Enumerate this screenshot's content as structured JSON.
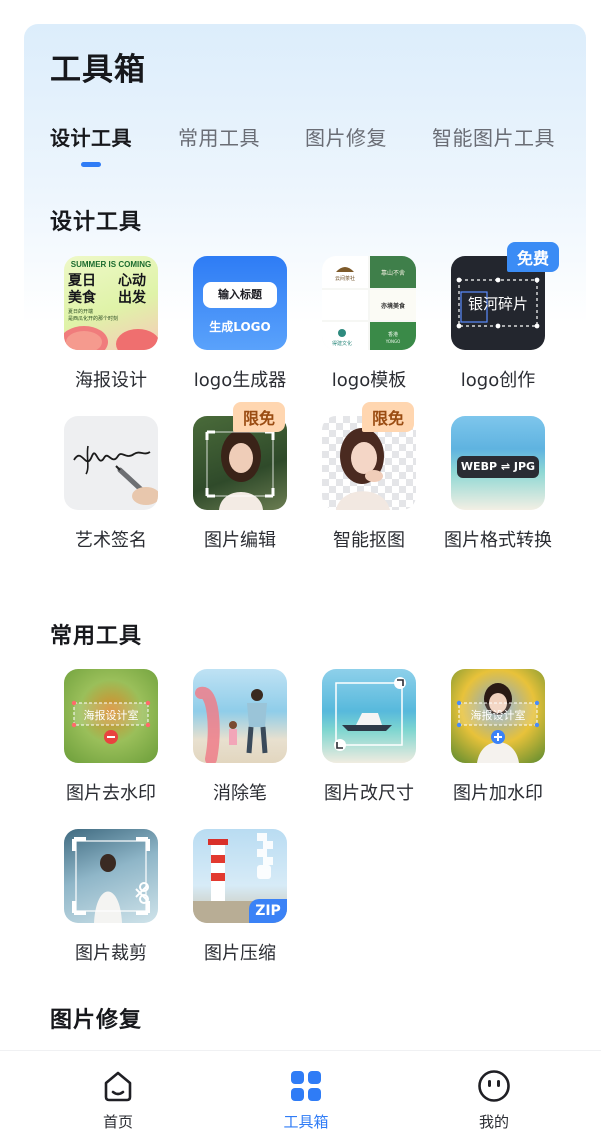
{
  "header": {
    "title": "工具箱"
  },
  "tabs": [
    {
      "label": "设计工具",
      "active": true
    },
    {
      "label": "常用工具",
      "active": false
    },
    {
      "label": "图片修复",
      "active": false
    },
    {
      "label": "智能图片工具",
      "active": false
    }
  ],
  "sections": {
    "design": {
      "title": "设计工具",
      "tools": [
        {
          "label": "海报设计",
          "thumb_text": [
            "SUMMER IS COMING",
            "夏日",
            "心动",
            "美食",
            "出发",
            "夏日的开端",
            "是西瓜化开的那个时刻"
          ]
        },
        {
          "label": "logo生成器",
          "thumb_text": [
            "输入标题",
            "生成LOGO"
          ]
        },
        {
          "label": "logo模板",
          "thumb_text": [
            "云间茶社",
            "靠山不舍",
            "亦境美食",
            "得建文化",
            "香港",
            "YONGO"
          ]
        },
        {
          "label": "logo创作",
          "badge": "免费",
          "thumb_text": [
            "银河碎片"
          ]
        },
        {
          "label": "艺术签名"
        },
        {
          "label": "图片编辑",
          "badge": "限免"
        },
        {
          "label": "智能抠图",
          "badge": "限免"
        },
        {
          "label": "图片格式转换",
          "thumb_text": [
            "WEBP ⇌ JPG"
          ]
        }
      ]
    },
    "common": {
      "title": "常用工具",
      "tools": [
        {
          "label": "图片去水印",
          "thumb_text": [
            "海报设计室"
          ]
        },
        {
          "label": "消除笔"
        },
        {
          "label": "图片改尺寸"
        },
        {
          "label": "图片加水印",
          "thumb_text": [
            "海报设计室"
          ]
        },
        {
          "label": "图片裁剪"
        },
        {
          "label": "图片压缩",
          "thumb_text": [
            "ZIP"
          ]
        }
      ]
    },
    "repair": {
      "title": "图片修复"
    }
  },
  "bottom_nav": [
    {
      "label": "首页",
      "icon": "home-icon",
      "active": false
    },
    {
      "label": "工具箱",
      "icon": "grid-icon",
      "active": true
    },
    {
      "label": "我的",
      "icon": "smiley-icon",
      "active": false
    }
  ],
  "colors": {
    "accent": "#2f7cf6",
    "badge_blue": "#3b8cf5",
    "badge_orange": "#ffd6b0"
  }
}
